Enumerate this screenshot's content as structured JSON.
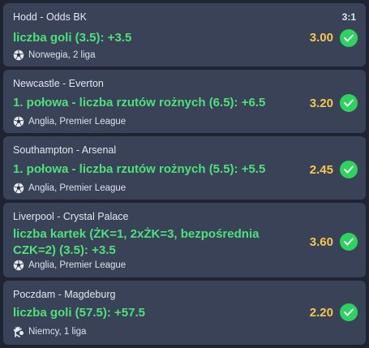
{
  "bets": [
    {
      "match": "Hodd - Odds BK",
      "score": "3:1",
      "pick": "liczba goli (3.5): +3.5",
      "odds": "3.00",
      "sport_icon": "football-icon",
      "league": "Norwegia, 2 liga"
    },
    {
      "match": "Newcastle - Everton",
      "score": "",
      "pick": "1. połowa - liczba rzutów rożnych (6.5): +6.5",
      "odds": "3.20",
      "sport_icon": "football-icon",
      "league": "Anglia, Premier League"
    },
    {
      "match": "Southampton - Arsenal",
      "score": "",
      "pick": "1. połowa - liczba rzutów rożnych (5.5): +5.5",
      "odds": "2.45",
      "sport_icon": "football-icon",
      "league": "Anglia, Premier League"
    },
    {
      "match": "Liverpool - Crystal Palace",
      "score": "",
      "pick": "liczba kartek (ŻK=1, 2xŻK=3, bezpośrednia CZK=2) (3.5): +3.5",
      "odds": "3.60",
      "sport_icon": "football-icon",
      "league": "Anglia, Premier League"
    },
    {
      "match": "Poczdam - Magdeburg",
      "score": "",
      "pick": "liczba goli (57.5): +57.5",
      "odds": "2.20",
      "sport_icon": "handball-icon",
      "league": "Niemcy, 1 liga"
    }
  ],
  "colors": {
    "background": "#1f2433",
    "card": "#394257",
    "pick": "#4ee07a",
    "odds": "#f5c84b",
    "check": "#2ed35f"
  }
}
